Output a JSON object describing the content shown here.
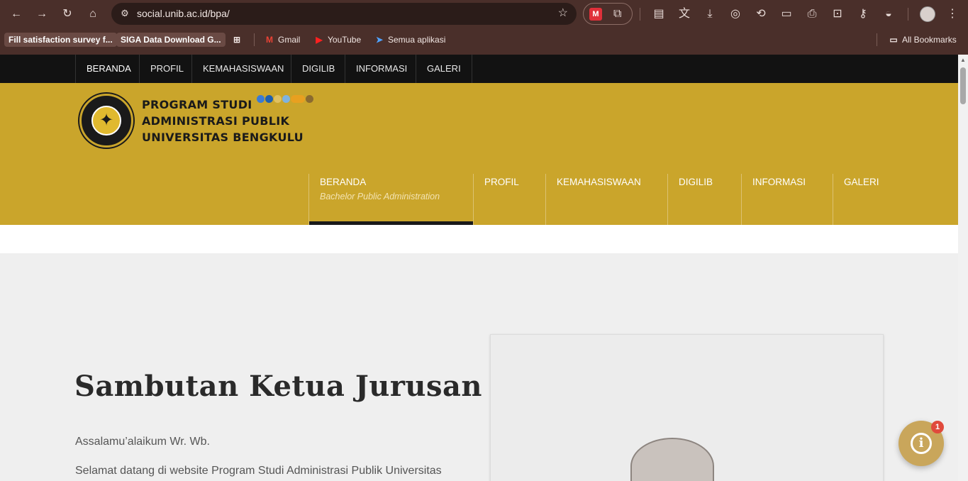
{
  "browser": {
    "url": "social.unib.ac.id/bpa/",
    "ext_badge": "M",
    "bookmarks": [
      {
        "label": "Fill satisfaction survey f..."
      },
      {
        "label": "SIGA Data Download G..."
      },
      {
        "label": "Gmail"
      },
      {
        "label": "YouTube"
      },
      {
        "label": "Semua aplikasi"
      }
    ],
    "all_bookmarks": "All Bookmarks"
  },
  "topnav": {
    "items": [
      "BERANDA",
      "PROFIL",
      "KEMAHASISWAAN",
      "DIGILIB",
      "INFORMASI",
      "GALERI"
    ]
  },
  "header": {
    "brand_line1": "PROGRAM STUDI",
    "brand_line2": "ADMINISTRASI PUBLIK",
    "brand_line3": "UNIVERSITAS BENGKULU"
  },
  "mainnav": {
    "items": [
      {
        "label": "BERANDA",
        "sub": "Bachelor Public Administration"
      },
      {
        "label": "PROFIL"
      },
      {
        "label": "KEMAHASISWAAN"
      },
      {
        "label": "DIGILIB"
      },
      {
        "label": "INFORMASI"
      },
      {
        "label": "GALERI"
      }
    ]
  },
  "content": {
    "heading": "Sambutan Ketua Jurusan",
    "greeting": "Assalamu’alaikum Wr. Wb.",
    "intro": "Selamat datang di website Program Studi Administrasi Publik Universitas"
  },
  "fab": {
    "icon": "i",
    "badge": "1"
  },
  "colors": {
    "chrome": "#4a2f2a",
    "header_gold": "#caa52b",
    "topnav_bg": "#121212",
    "content_bg": "#efefef",
    "fab": "#c9a65b",
    "badge_red": "#e04a3c"
  }
}
